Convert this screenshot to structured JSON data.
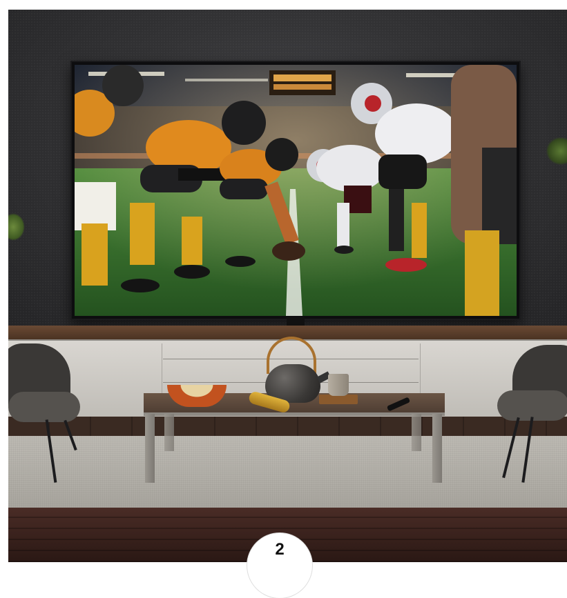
{
  "scene": {
    "page_number": "2",
    "colors": {
      "wall": "#333335",
      "field": "#2f6b2a",
      "team_orange": "#e08a1e",
      "team_white": "#e9e9ec",
      "helmet_red": "#b8242a",
      "rug": "#b5b2ab",
      "floor": "#3a2a22"
    }
  }
}
